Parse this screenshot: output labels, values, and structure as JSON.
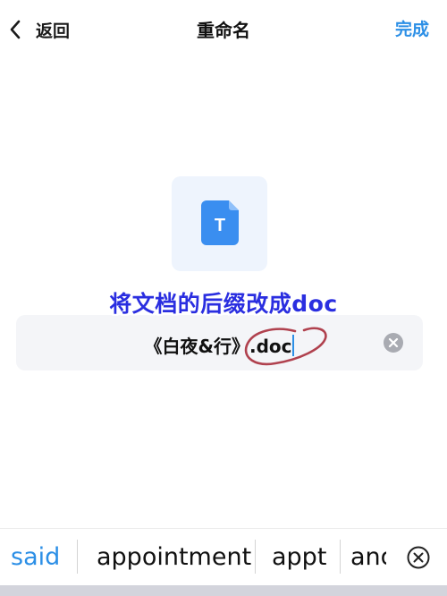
{
  "header": {
    "back_label": "返回",
    "title": "重命名",
    "done_label": "完成"
  },
  "file": {
    "icon_letter": "T",
    "icon_color": "#3a8ef0"
  },
  "annotation": {
    "text": "将文档的后缀改成doc",
    "color": "#2a2ee0"
  },
  "rename_field": {
    "base_name": "《白夜&行》",
    "extension": ".doc"
  },
  "suggestions": {
    "items": [
      "said",
      "appointment",
      "appt",
      "and"
    ],
    "active_index": 0
  },
  "colors": {
    "accent": "#2c8fe6",
    "annotation_circle": "#b0414e"
  }
}
